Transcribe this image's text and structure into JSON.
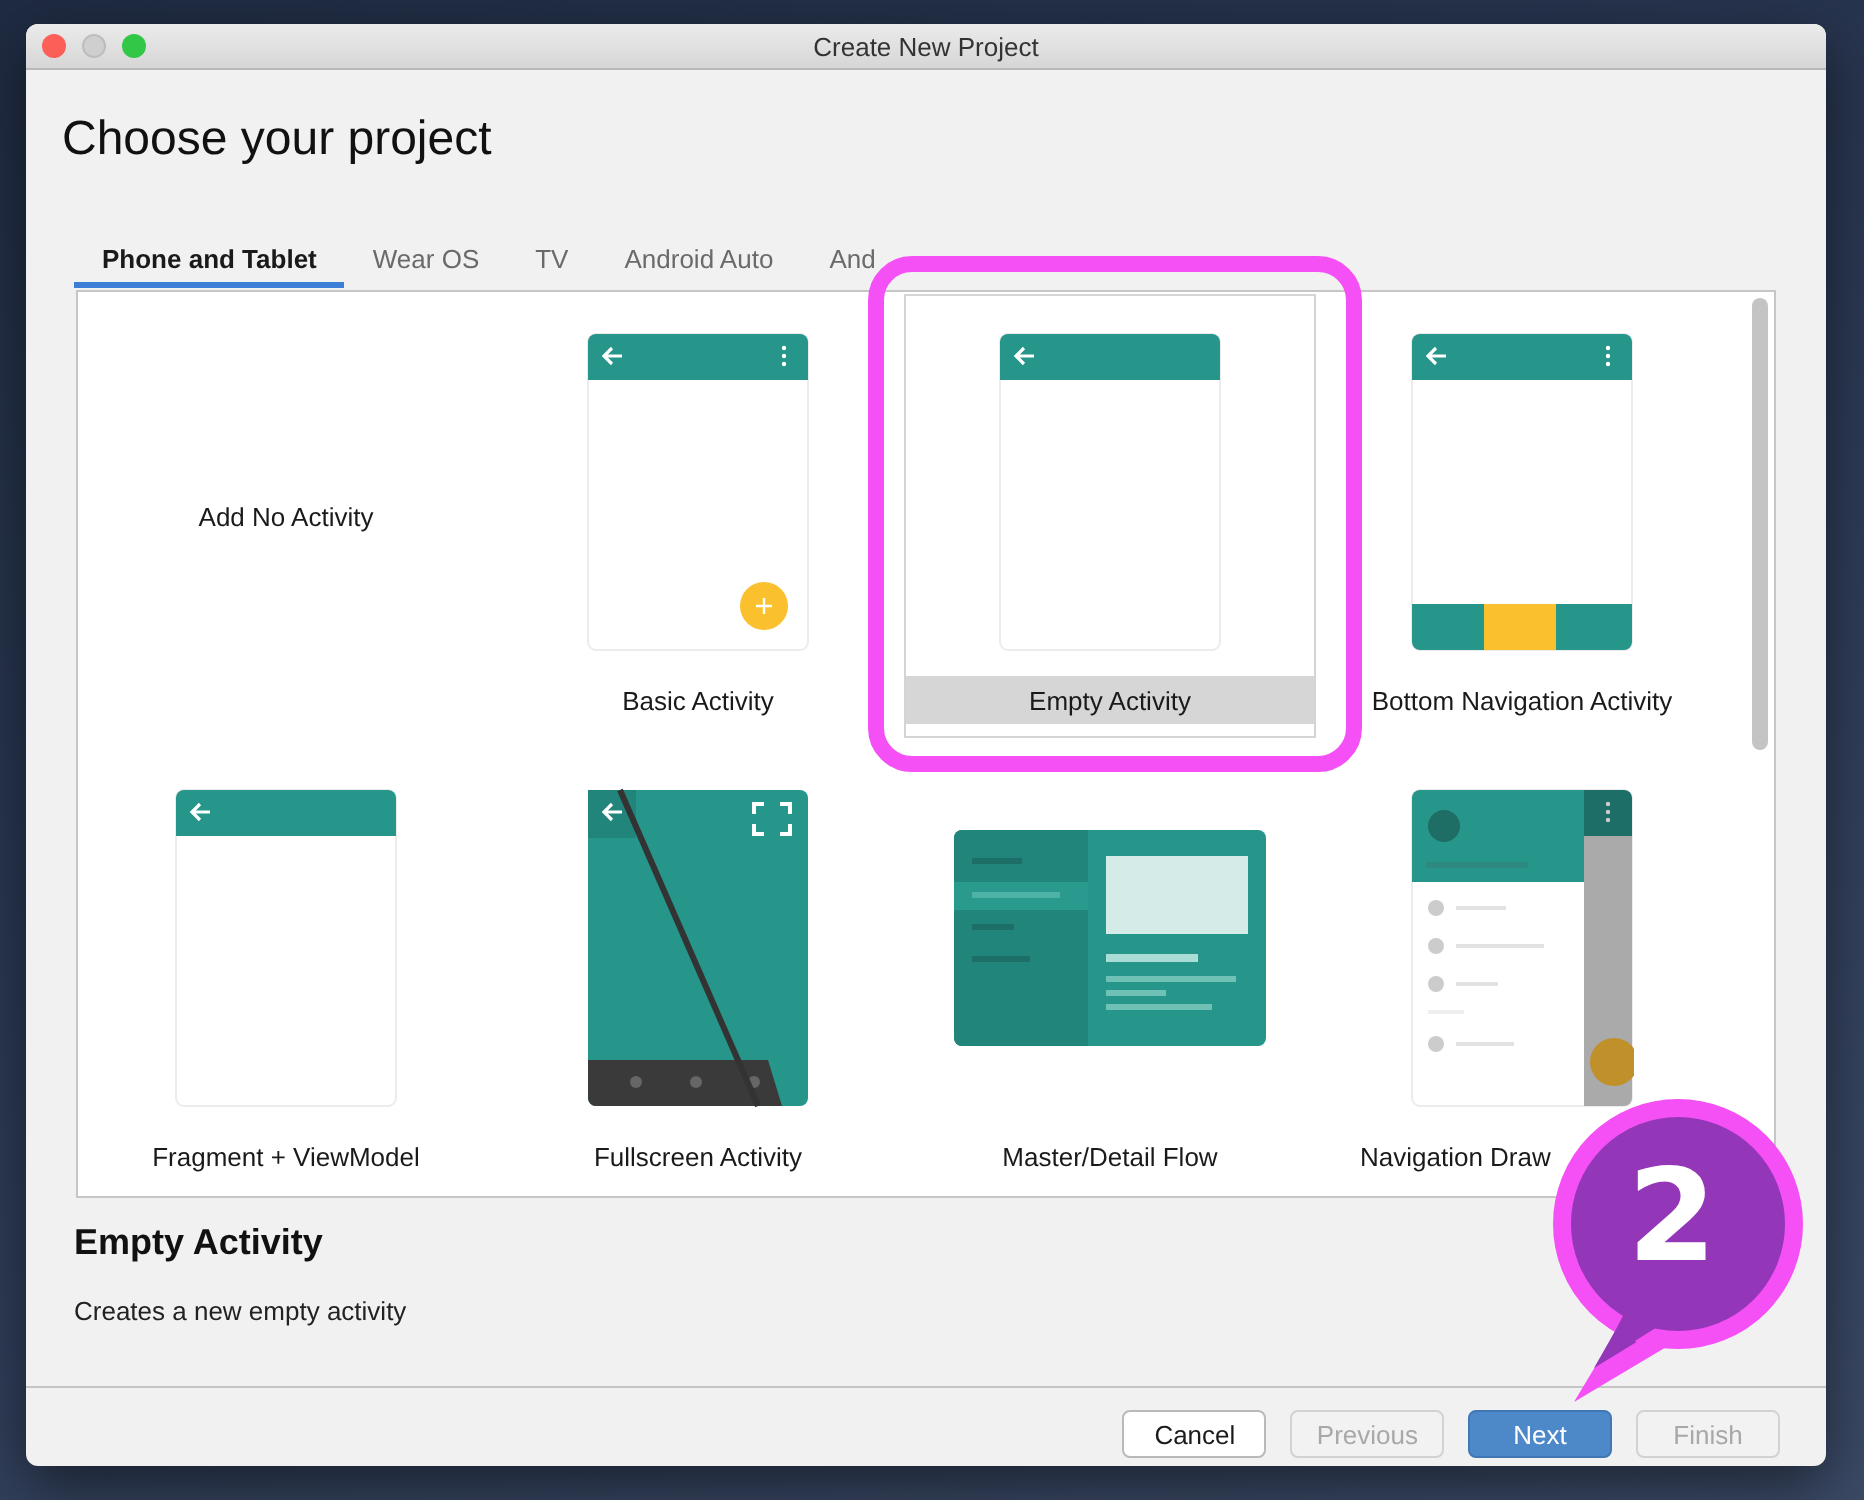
{
  "window": {
    "title": "Create New Project"
  },
  "heading": "Choose your project",
  "tabs": [
    {
      "label": "Phone and Tablet",
      "selected": true
    },
    {
      "label": "Wear OS",
      "selected": false
    },
    {
      "label": "TV",
      "selected": false
    },
    {
      "label": "Android Auto",
      "selected": false
    },
    {
      "label": "And",
      "selected": false
    }
  ],
  "templates": [
    {
      "label": "Add No Activity",
      "kind": "none",
      "selected": false
    },
    {
      "label": "Basic Activity",
      "kind": "basic",
      "selected": false
    },
    {
      "label": "Empty Activity",
      "kind": "empty",
      "selected": true
    },
    {
      "label": "Bottom Navigation Activity",
      "kind": "bottom_nav",
      "selected": false
    },
    {
      "label": "Fragment + ViewModel",
      "kind": "fragment",
      "selected": false
    },
    {
      "label": "Fullscreen Activity",
      "kind": "fullscreen",
      "selected": false
    },
    {
      "label": "Master/Detail Flow",
      "kind": "master_detail",
      "selected": false
    },
    {
      "label": "Navigation Draw",
      "kind": "nav_drawer",
      "selected": false
    }
  ],
  "description": {
    "title": "Empty Activity",
    "text": "Creates a new empty activity"
  },
  "buttons": [
    {
      "label": "Cancel",
      "kind": "default",
      "disabled": false
    },
    {
      "label": "Previous",
      "kind": "default",
      "disabled": true
    },
    {
      "label": "Next",
      "kind": "primary",
      "disabled": false
    },
    {
      "label": "Finish",
      "kind": "default",
      "disabled": true
    }
  ],
  "annotations": {
    "highlight_frame": true,
    "callout": "2"
  }
}
